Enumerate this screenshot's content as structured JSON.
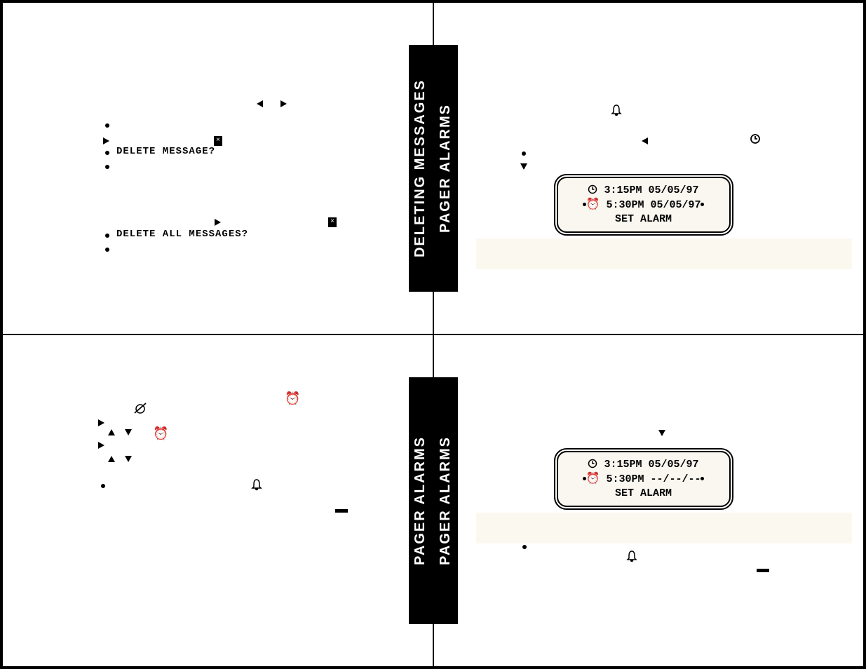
{
  "panels": {
    "tl": {
      "tab": "DELETING MESSAGES",
      "line1": "DELETE MESSAGE?",
      "line2": "DELETE ALL MESSAGES?"
    },
    "tr": {
      "tab": "PAGER ALARMS",
      "lcd": {
        "row1": "3:15PM 05/05/97",
        "row2_time": "5:30PM",
        "row2_date": "05/05/97",
        "row3": "SET ALARM"
      }
    },
    "bl": {
      "tab": "PAGER ALARMS"
    },
    "br": {
      "tab": "PAGER ALARMS",
      "lcd": {
        "row1": "3:15PM 05/05/97",
        "row2_time": "5:30PM",
        "row2_date": "--/--/--",
        "row3": "SET ALARM"
      }
    }
  }
}
